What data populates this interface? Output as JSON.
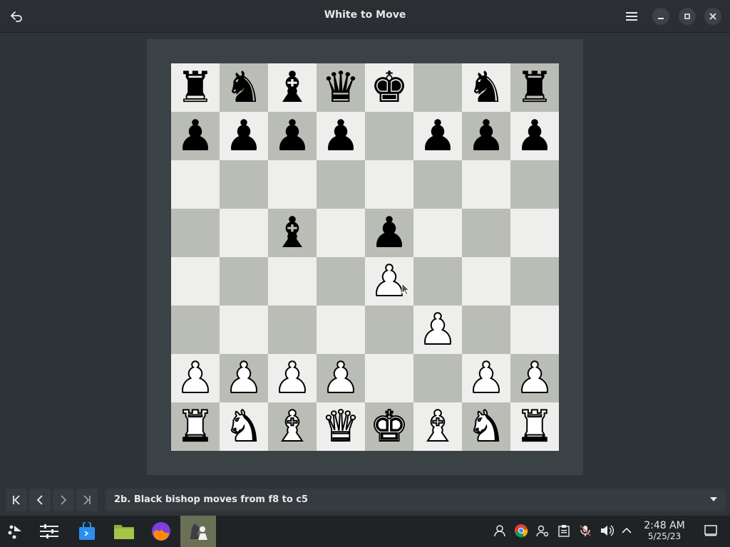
{
  "window": {
    "title": "White to Move"
  },
  "board": {
    "ranks": [
      [
        "r",
        "n",
        "b",
        "q",
        "k",
        "",
        "n",
        "r"
      ],
      [
        "p",
        "p",
        "p",
        "p",
        "",
        "p",
        "p",
        "p"
      ],
      [
        "",
        "",
        "",
        "",
        "",
        "",
        "",
        ""
      ],
      [
        "",
        "",
        "b",
        "",
        "p",
        "",
        "",
        ""
      ],
      [
        "",
        "",
        "",
        "",
        "P",
        "",
        "",
        ""
      ],
      [
        "",
        "",
        "",
        "",
        "",
        "P",
        "",
        ""
      ],
      [
        "P",
        "P",
        "P",
        "P",
        "",
        "",
        "P",
        "P"
      ],
      [
        "R",
        "N",
        "B",
        "Q",
        "K",
        "B",
        "N",
        "R"
      ]
    ]
  },
  "glyphs": {
    "K": "♚",
    "Q": "♛",
    "R": "♜",
    "B": "♝",
    "N": "♞",
    "P": "♟",
    "k": "♚",
    "q": "♛",
    "r": "♜",
    "b": "♝",
    "n": "♞",
    "p": "♟"
  },
  "moves": {
    "current": "2b. Black bishop moves from f8 to c5"
  },
  "clock": {
    "time": "2:48 AM",
    "date": "5/25/23"
  },
  "colors": {
    "light_square": "#eeeeec",
    "dark_square": "#babdb6",
    "frame": "#3b4246"
  }
}
